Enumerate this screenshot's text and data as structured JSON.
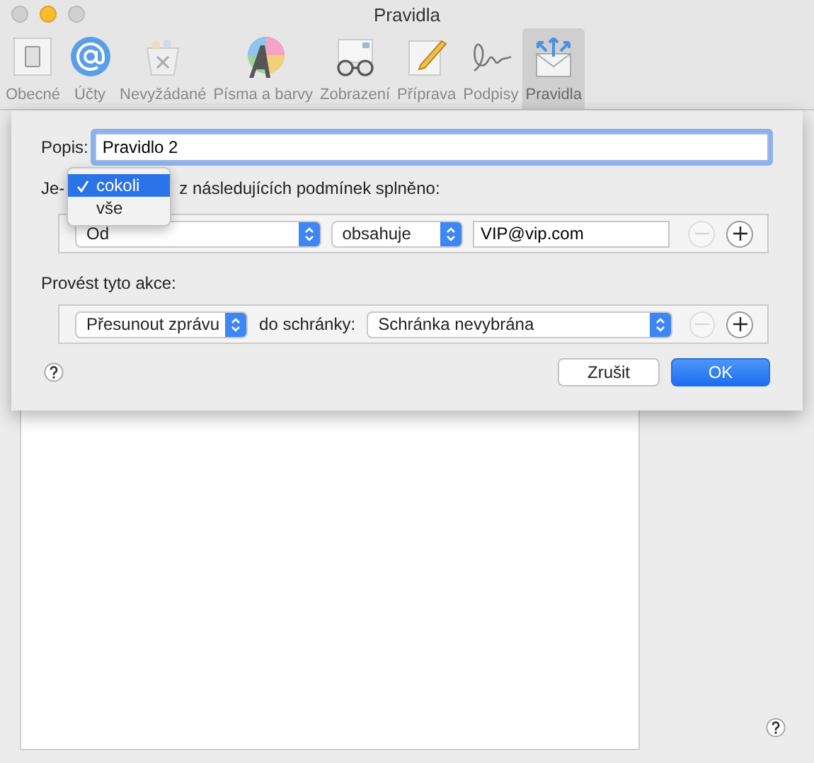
{
  "window": {
    "title": "Pravidla"
  },
  "toolbar": [
    {
      "label": "Obecné",
      "selected": false
    },
    {
      "label": "Účty",
      "selected": false
    },
    {
      "label": "Nevyžádané",
      "selected": false
    },
    {
      "label": "Písma a barvy",
      "selected": false
    },
    {
      "label": "Zobrazení",
      "selected": false
    },
    {
      "label": "Příprava",
      "selected": false
    },
    {
      "label": "Podpisy",
      "selected": false
    },
    {
      "label": "Pravidla",
      "selected": true
    }
  ],
  "sheet": {
    "description": {
      "label": "Popis:",
      "value": "Pravidlo 2"
    },
    "match": {
      "label_start": "Je-",
      "label_end": "z následujících podmínek splněno:",
      "menu": [
        {
          "label": "cokoli",
          "selected": true
        },
        {
          "label": "vše",
          "selected": false
        }
      ]
    },
    "conditions": [
      {
        "field": "Od",
        "operator": "obsahuje",
        "value": "VIP@vip.com",
        "remove_disabled": true
      }
    ],
    "actions_label": "Provést tyto akce:",
    "actions": [
      {
        "action": "Přesunout zprávu",
        "connector": "do schránky:",
        "target": "Schránka nevybrána",
        "remove_disabled": true
      }
    ],
    "buttons": [
      {
        "label": "Zrušit",
        "kind": "cancel"
      },
      {
        "label": "OK",
        "kind": "default"
      }
    ]
  }
}
